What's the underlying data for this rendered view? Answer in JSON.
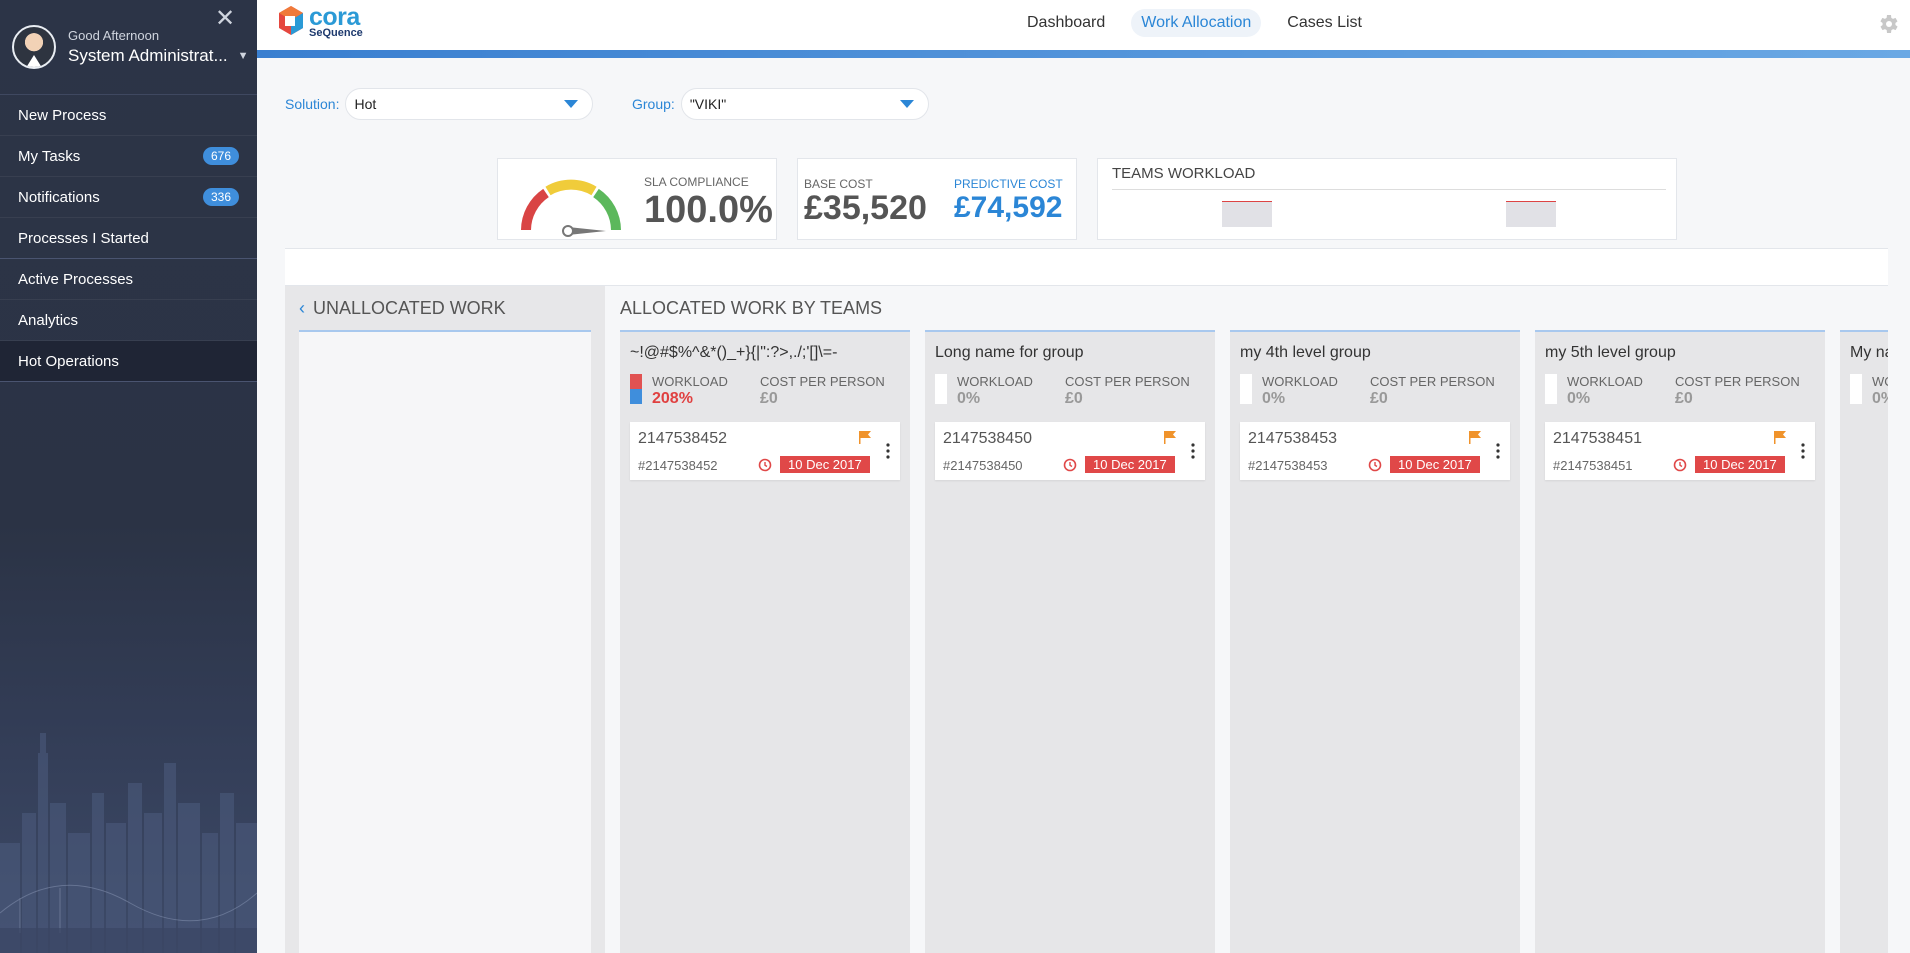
{
  "sidebar": {
    "greeting": "Good Afternoon",
    "user_name": "System Administrat...",
    "items": [
      {
        "label": "New Process",
        "badge": null
      },
      {
        "label": "My Tasks",
        "badge": "676"
      },
      {
        "label": "Notifications",
        "badge": "336"
      },
      {
        "label": "Processes I Started",
        "badge": null
      },
      {
        "label": "Active Processes",
        "badge": null
      },
      {
        "label": "Analytics",
        "badge": null
      },
      {
        "label": "Hot Operations",
        "badge": null
      }
    ]
  },
  "header": {
    "logo_top": "cora",
    "logo_bottom": "SeQuence",
    "tabs": [
      {
        "label": "Dashboard"
      },
      {
        "label": "Work Allocation"
      },
      {
        "label": "Cases List"
      }
    ]
  },
  "filters": {
    "solution_label": "Solution:",
    "solution_value": "Hot",
    "group_label": "Group:",
    "group_value": "\"VIKI\""
  },
  "widgets": {
    "sla_label": "SLA COMPLIANCE",
    "sla_value": "100.0%",
    "base_cost_label": "BASE COST",
    "base_cost_value": "£35,520",
    "predictive_cost_label": "PREDICTIVE COST",
    "predictive_cost_value": "£74,592",
    "teams_workload_label": "TEAMS WORKLOAD"
  },
  "unallocated": {
    "title": "UNALLOCATED WORK"
  },
  "allocated": {
    "title": "ALLOCATED WORK BY TEAMS",
    "workload_label": "WORKLOAD",
    "cost_label": "COST PER PERSON",
    "teams": [
      {
        "name": "~!@#$%^&*()_+}{|\":?>,./;'[]\\=-",
        "workload": "208%",
        "cost": "£0",
        "case_number": "2147538452",
        "case_id": "#2147538452",
        "due": "10 Dec 2017"
      },
      {
        "name": "Long name for group",
        "workload": "0%",
        "cost": "£0",
        "case_number": "2147538450",
        "case_id": "#2147538450",
        "due": "10 Dec 2017"
      },
      {
        "name": "my 4th level group",
        "workload": "0%",
        "cost": "£0",
        "case_number": "2147538453",
        "case_id": "#2147538453",
        "due": "10 Dec 2017"
      },
      {
        "name": "my 5th level group",
        "workload": "0%",
        "cost": "£0",
        "case_number": "2147538451",
        "case_id": "#2147538451",
        "due": "10 Dec 2017"
      },
      {
        "name": "My na",
        "workload": "0%",
        "cost": "",
        "case_number": "",
        "case_id": "",
        "due": ""
      }
    ]
  },
  "colors": {
    "accent": "#2b86d6",
    "danger": "#e04848",
    "sidebar_bg": "#2c3447"
  }
}
